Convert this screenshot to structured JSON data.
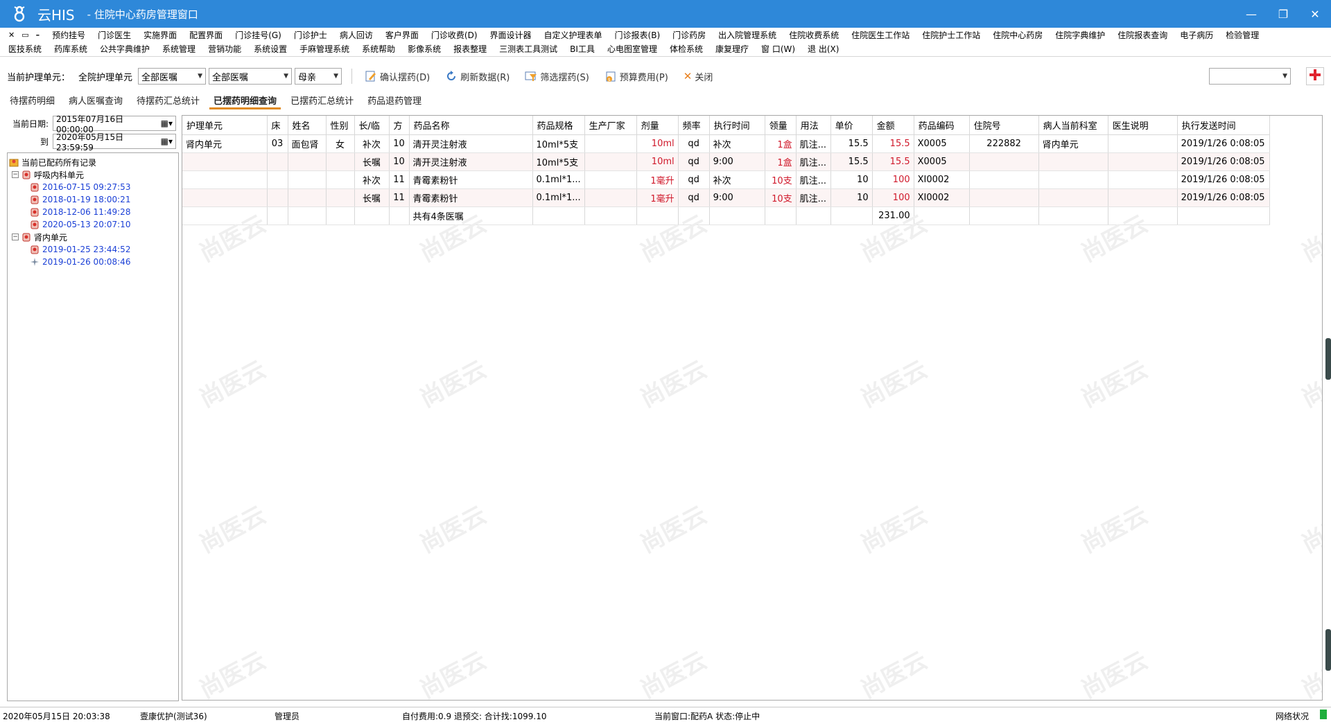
{
  "window": {
    "app_name": "云HIS",
    "title": "- 住院中心药房管理窗口",
    "controls": {
      "minimize": "—",
      "restore": "❐",
      "close": "✕"
    }
  },
  "menubar": {
    "row1": [
      "预约挂号",
      "门诊医生",
      "实施界面",
      "配置界面",
      "门诊挂号(G)",
      "门诊护士",
      "病人回访",
      "客户界面",
      "门诊收费(D)",
      "界面设计器",
      "自定义护理表单",
      "门诊报表(B)",
      "门诊药房",
      "出入院管理系统",
      "住院收费系统",
      "住院医生工作站",
      "住院护士工作站",
      "住院中心药房",
      "住院字典维护",
      "住院报表查询",
      "电子病历",
      "检验管理"
    ],
    "row2": [
      "医技系统",
      "药库系统",
      "公共字典维护",
      "系统管理",
      "营销功能",
      "系统设置",
      "手麻管理系统",
      "系统帮助",
      "影像系统",
      "报表整理",
      "三测表工具测试",
      "BI工具",
      "心电图室管理",
      "体检系统",
      "康复理疗",
      "窗 口(W)",
      "退 出(X)"
    ],
    "mdi": [
      "✕",
      "▭",
      "–"
    ]
  },
  "toolbar": {
    "unit_label": "当前护理单元：",
    "unit_value": "全院护理单元",
    "combo1": "全部医嘱",
    "combo2": "全部医嘱",
    "combo3": "母亲",
    "confirm": "确认摆药(D)",
    "refresh": "刷新数据(R)",
    "filter": "筛选摆药(S)",
    "budget": "预算费用(P)",
    "close": "关闭",
    "right_combo": ""
  },
  "tabs": [
    "待摆药明细",
    "病人医嘱查询",
    "待摆药汇总统计",
    "已摆药明细查询",
    "已摆药汇总统计",
    "药品退药管理"
  ],
  "active_tab": "已摆药明细查询",
  "left": {
    "date_label": "当前日期:",
    "date_from": "2015年07月16日 00:00:00",
    "to_label": "到",
    "date_to": "2020年05月15日 23:59:59",
    "tree": {
      "root": "当前已配药所有记录",
      "groups": [
        {
          "name": "呼吸内科单元",
          "dates": [
            "2016-07-15 09:27:53",
            "2018-01-19 18:00:21",
            "2018-12-06 11:49:28",
            "2020-05-13 20:07:10"
          ]
        },
        {
          "name": "肾内单元",
          "dates": [
            "2019-01-25 23:44:52",
            "2019-01-26 00:08:46"
          ]
        }
      ]
    }
  },
  "grid": {
    "columns": [
      "护理单元",
      "床",
      "姓名",
      "性别",
      "长/临",
      "方",
      "药品名称",
      "药品规格",
      "生产厂家",
      "剂量",
      "频率",
      "执行时间",
      "领量",
      "用法",
      "单价",
      "金额",
      "药品编码",
      "住院号",
      "病人当前科室",
      "医生说明",
      "执行发送时间"
    ],
    "rows": [
      [
        "肾内单元",
        "03",
        "面包肾",
        "女",
        "补次",
        "10",
        "清开灵注射液",
        "10ml*5支",
        "",
        "10ml",
        "qd",
        "补次",
        "1盒",
        "肌注...",
        "15.5",
        "15.5",
        "X0005",
        "222882",
        "肾内单元",
        "",
        "2019/1/26 0:08:05"
      ],
      [
        "",
        "",
        "",
        "",
        "长嘱",
        "10",
        "清开灵注射液",
        "10ml*5支",
        "",
        "10ml",
        "qd",
        "9:00",
        "1盒",
        "肌注...",
        "15.5",
        "15.5",
        "X0005",
        "",
        "",
        "",
        "2019/1/26 0:08:05"
      ],
      [
        "",
        "",
        "",
        "",
        "补次",
        "11",
        "青霉素粉针",
        "0.1ml*1...",
        "",
        "1毫升",
        "qd",
        "补次",
        "10支",
        "肌注...",
        "10",
        "100",
        "XI0002",
        "",
        "",
        "",
        "2019/1/26 0:08:05"
      ],
      [
        "",
        "",
        "",
        "",
        "长嘱",
        "11",
        "青霉素粉针",
        "0.1ml*1...",
        "",
        "1毫升",
        "qd",
        "9:00",
        "10支",
        "肌注...",
        "10",
        "100",
        "XI0002",
        "",
        "",
        "",
        "2019/1/26 0:08:05"
      ]
    ],
    "summary_text": "共有4条医嘱",
    "summary_total": "231.00"
  },
  "watermark": "尚医云",
  "statusbar": {
    "datetime": "2020年05月15日 20:03:38",
    "user": "壹康优护(测试36)",
    "role": "管理员",
    "fees": "自付费用:0.9 退预交: 合计找:1099.10",
    "window": "当前窗口:配药A  状态:停止中",
    "network": "网络状况"
  },
  "colors": {
    "titlebar": "#2e88d9",
    "accent_tab": "#e08a1e",
    "red_value": "#d0182a",
    "tree_date": "#1a3fd6"
  }
}
